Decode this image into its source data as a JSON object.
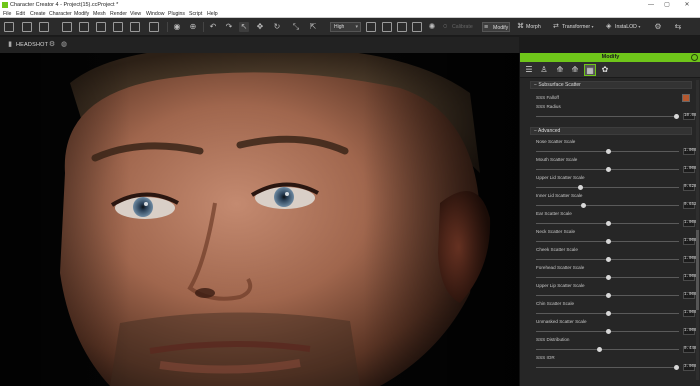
{
  "app": {
    "title": "Character Creator 4 - Project(15).ccProject *",
    "accent": "#6fc61a"
  },
  "menu": [
    "File",
    "Edit",
    "Create",
    "Character",
    "Modify",
    "Mesh",
    "Render",
    "View",
    "Window",
    "Plugins",
    "Script",
    "Help"
  ],
  "toolbar": {
    "quality": "High",
    "tools": {
      "calibrate": "Calibrate",
      "modify": "Modify",
      "morph": "Morph",
      "transformer": "Transformer",
      "instalod": "InstaLOD"
    }
  },
  "viewport": {
    "label": "HEADSHOT"
  },
  "panel": {
    "title": "Modify",
    "subsurface": {
      "header": "Subsurface Scatter",
      "falloff_label": "SSS Falloff",
      "falloff_color": "#b5582f",
      "radius_label": "SSS Radius",
      "radius_value": "10.000",
      "radius_level": 0.98
    },
    "advanced": {
      "header": "Advanced",
      "items": [
        {
          "label": "Nose Scatter Scale",
          "value": "1.000",
          "level": 0.5
        },
        {
          "label": "Mouth Scatter Scale",
          "value": "1.000",
          "level": 0.5
        },
        {
          "label": "Upper Lid Scatter Scale",
          "value": "0.620",
          "level": 0.31
        },
        {
          "label": "Inner Lid Scatter Scale",
          "value": "0.652",
          "level": 0.33
        },
        {
          "label": "Ear Scatter Scale",
          "value": "1.000",
          "level": 0.5
        },
        {
          "label": "Neck Scatter Scale",
          "value": "1.000",
          "level": 0.5
        },
        {
          "label": "Cheek Scatter Scale",
          "value": "1.000",
          "level": 0.5
        },
        {
          "label": "Forehead Scatter Scale",
          "value": "1.000",
          "level": 0.5
        },
        {
          "label": "Upper Lip Scatter Scale",
          "value": "1.000",
          "level": 0.5
        },
        {
          "label": "Chin Scatter Scale",
          "value": "1.000",
          "level": 0.5
        },
        {
          "label": "Unmasked Scatter Scale",
          "value": "1.000",
          "level": 0.5
        },
        {
          "label": "SSS Distribution",
          "value": "0.440",
          "level": 0.44
        },
        {
          "label": "SSS IOR",
          "value": "3.000",
          "level": 0.98
        }
      ]
    }
  }
}
